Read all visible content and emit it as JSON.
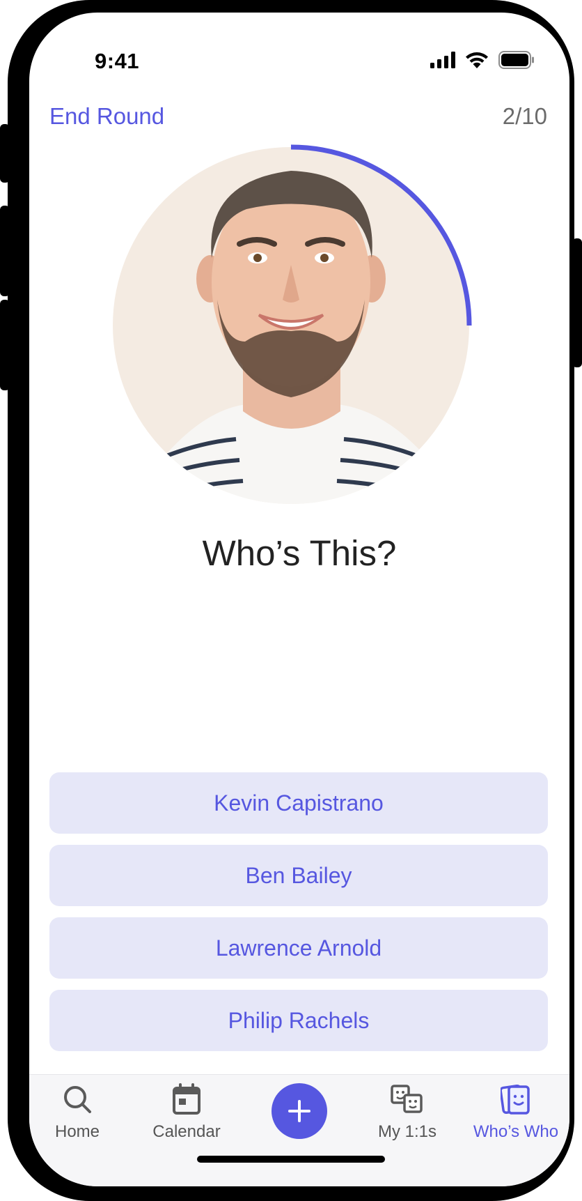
{
  "status_bar": {
    "time": "9:41"
  },
  "header": {
    "end_round_label": "End Round",
    "progress_label": "2/10"
  },
  "quiz": {
    "question": "Who’s This?",
    "timer_fraction": 0.25,
    "answers": [
      {
        "label": "Kevin Capistrano"
      },
      {
        "label": "Ben Bailey"
      },
      {
        "label": "Lawrence Arnold"
      },
      {
        "label": "Philip Rachels"
      }
    ]
  },
  "tabbar": {
    "items": [
      {
        "label": "Home",
        "icon": "search-icon",
        "active": false
      },
      {
        "label": "Calendar",
        "icon": "calendar-icon",
        "active": false
      },
      {
        "label": "My 1:1s",
        "icon": "faces-icon",
        "active": false
      },
      {
        "label": "Who’s Who",
        "icon": "cards-face-icon",
        "active": true
      }
    ],
    "center_action_icon": "plus-icon"
  },
  "colors": {
    "accent": "#5657e0",
    "answer_bg": "#e6e7f8",
    "tabbar_bg": "#f6f6f8",
    "avatar_bg": "#f4ebe2"
  }
}
